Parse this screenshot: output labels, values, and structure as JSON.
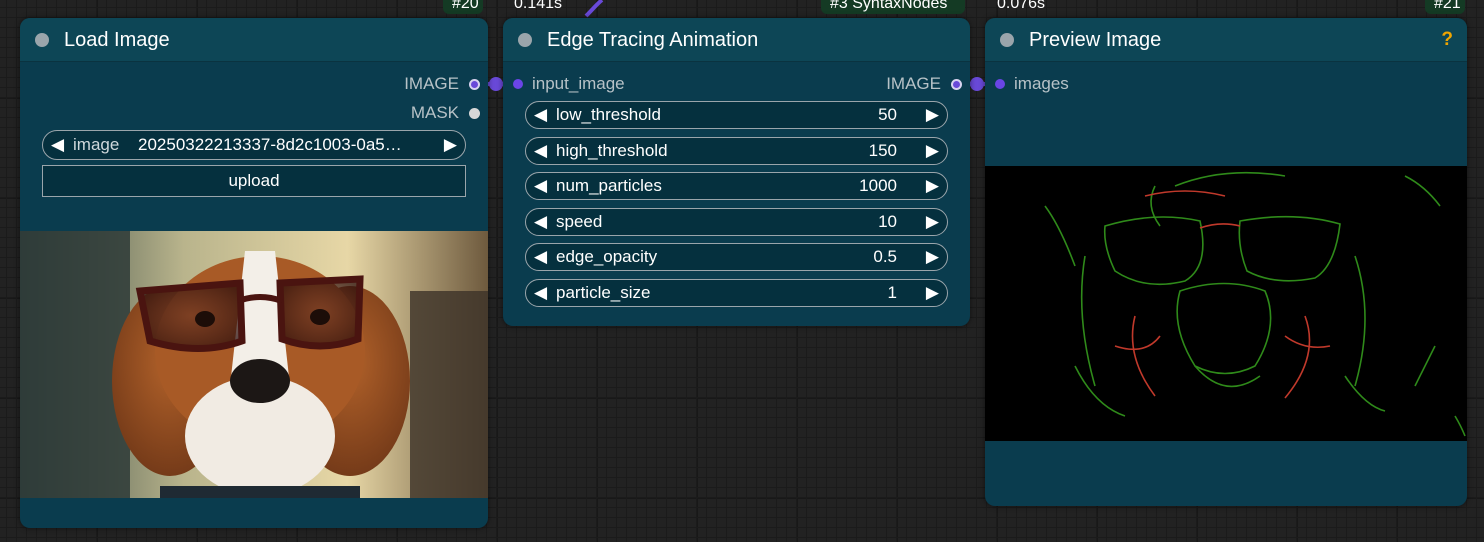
{
  "badges": {
    "load_image_id": "#20",
    "edge_exec_time": "0.141s",
    "edge_source": "#3 SyntaxNodes",
    "preview_exec_time": "0.076s",
    "preview_id": "#21"
  },
  "load_image": {
    "title": "Load Image",
    "outputs": [
      "IMAGE",
      "MASK"
    ],
    "image_widget": {
      "label": "image",
      "value": "20250322213337-8d2c1003-0a5…"
    },
    "upload_label": "upload",
    "photo_description_icon": "beagle-with-glasses-photo"
  },
  "edge_tracing": {
    "title": "Edge Tracing Animation",
    "input": "input_image",
    "output": "IMAGE",
    "widgets": [
      {
        "label": "low_threshold",
        "value": "50"
      },
      {
        "label": "high_threshold",
        "value": "150"
      },
      {
        "label": "num_particles",
        "value": "1000"
      },
      {
        "label": "speed",
        "value": "10"
      },
      {
        "label": "edge_opacity",
        "value": "0.5"
      },
      {
        "label": "particle_size",
        "value": "1"
      }
    ]
  },
  "preview_image": {
    "title": "Preview Image",
    "input": "images",
    "help": "?",
    "preview_icon": "edge-trace-preview-image"
  },
  "colors": {
    "node_body": "#0a3c4e",
    "node_header": "#0d4656",
    "image_link": "#6949d8",
    "help_accent": "#f0a500",
    "edge_green": "#2f8a1a",
    "edge_red": "#c0392b"
  }
}
